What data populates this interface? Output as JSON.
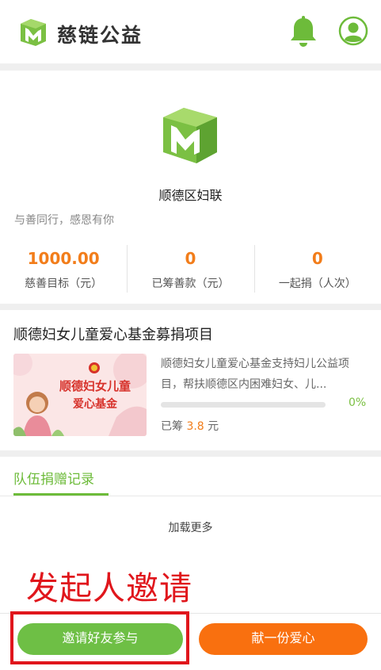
{
  "header": {
    "brand": "慈链公益",
    "logo_icon": "app-logo-icon",
    "bell_icon": "bell-icon",
    "user_icon": "user-icon",
    "accent_color": "#6dbb3a"
  },
  "org": {
    "name": "顺德区妇联",
    "slogan": "与善同行，感恩有你"
  },
  "stats": [
    {
      "value": "1000.00",
      "label": "慈善目标（元）"
    },
    {
      "value": "0",
      "label": "已筹善款（元）"
    },
    {
      "value": "0",
      "label": "一起捐（人次）"
    }
  ],
  "project": {
    "title": "顺德妇女儿童爱心基金募捐项目",
    "image_line1": "顺德妇女儿童",
    "image_line2": "爱心基金",
    "description": "顺德妇女儿童爱心基金支持妇儿公益项目，帮扶顺德区内困难妇女、儿...",
    "progress": 0,
    "progress_label": "0%",
    "raised_prefix": "已筹",
    "raised_amount": "3.8",
    "raised_unit": "元"
  },
  "tabs": {
    "records": "队伍捐赠记录"
  },
  "load_more": "加载更多",
  "annotation": "发起人邀请",
  "buttons": {
    "invite": "邀请好友参与",
    "donate": "献一份爱心"
  }
}
